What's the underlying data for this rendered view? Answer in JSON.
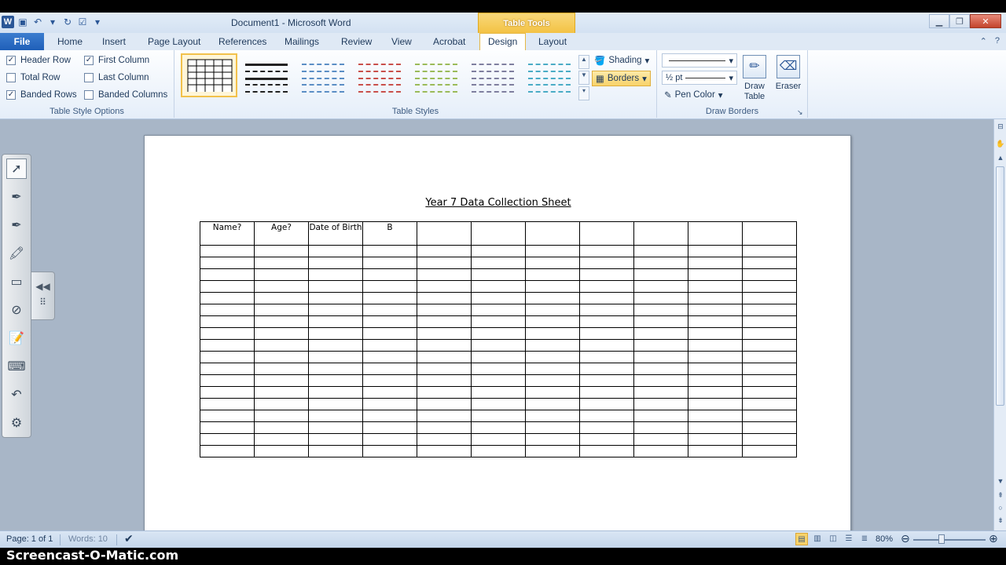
{
  "window": {
    "title": "Document1  -  Microsoft Word",
    "context_tab_header": "Table Tools"
  },
  "tabs": {
    "file": "File",
    "items": [
      "Home",
      "Insert",
      "Page Layout",
      "References",
      "Mailings",
      "Review",
      "View",
      "Acrobat",
      "Design",
      "Layout"
    ],
    "active": "Design"
  },
  "ribbon": {
    "style_options": {
      "label": "Table Style Options",
      "header_row": {
        "label": "Header Row",
        "checked": true
      },
      "total_row": {
        "label": "Total Row",
        "checked": false
      },
      "banded_rows": {
        "label": "Banded Rows",
        "checked": true
      },
      "first_column": {
        "label": "First Column",
        "checked": true
      },
      "last_column": {
        "label": "Last Column",
        "checked": false
      },
      "banded_columns": {
        "label": "Banded Columns",
        "checked": false
      }
    },
    "table_styles": {
      "label": "Table Styles",
      "shading": "Shading",
      "borders": "Borders",
      "style_colors": [
        "#000000",
        "#222222",
        "#5b8ec5",
        "#c9504b",
        "#9bbb59",
        "#7f7f9f",
        "#4bacc6"
      ]
    },
    "draw_borders": {
      "label": "Draw Borders",
      "line_weight": "½ pt",
      "pen_color": "Pen Color",
      "draw_table": "Draw Table",
      "eraser": "Eraser"
    }
  },
  "document": {
    "heading": "Year 7 Data Collection Sheet",
    "table": {
      "headers": [
        "Name?",
        "Age?",
        "Date of Birth",
        "B",
        "",
        "",
        "",
        "",
        "",
        "",
        ""
      ],
      "empty_rows": 18
    }
  },
  "statusbar": {
    "page": "Page: 1 of 1",
    "words": "Words: 10",
    "zoom": "80%",
    "zoom_level": 0.8
  },
  "watermark": "Screencast-O-Matic.com",
  "colors": {
    "accent": "#2b5797",
    "context_tab": "#f3c244",
    "ribbon_bg": "#e5eef9"
  }
}
